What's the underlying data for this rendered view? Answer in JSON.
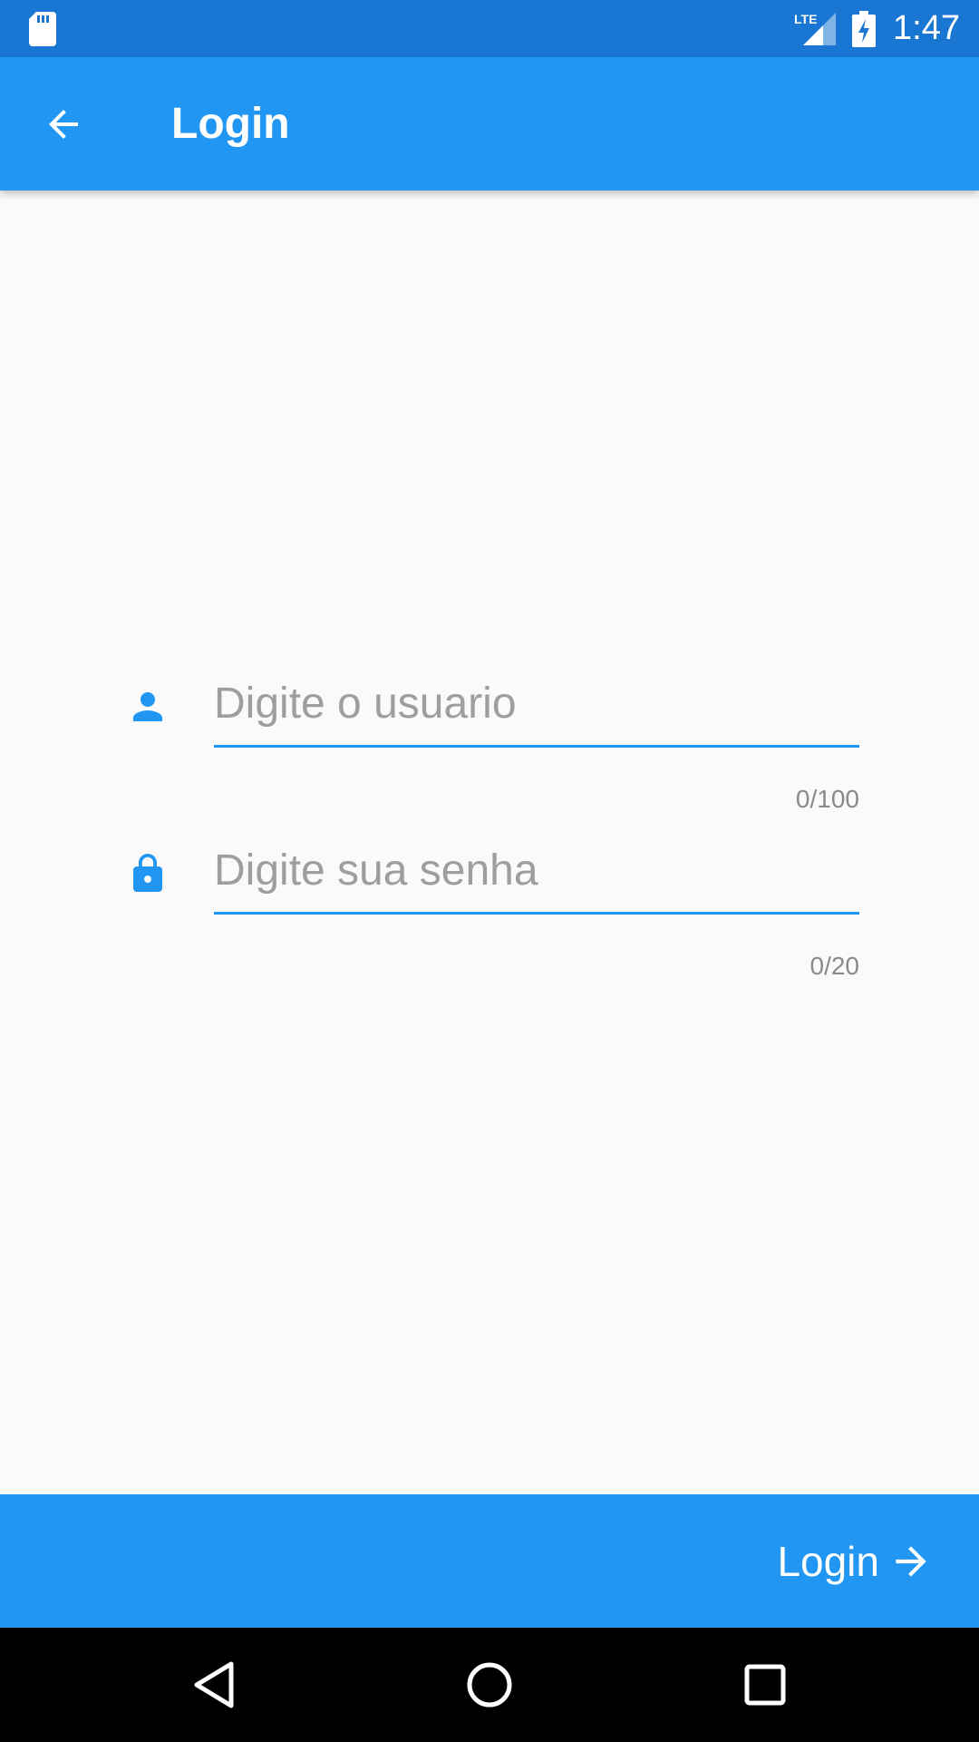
{
  "status_bar": {
    "time": "1:47",
    "network": "LTE",
    "icons": [
      "sd-card-icon",
      "signal-icon",
      "battery-charging-icon"
    ]
  },
  "app_bar": {
    "title": "Login",
    "back_icon": "arrow-back-icon"
  },
  "form": {
    "username": {
      "placeholder": "Digite o usuario",
      "value": "",
      "counter": "0/100",
      "icon": "person-icon"
    },
    "password": {
      "placeholder": "Digite sua senha",
      "value": "",
      "counter": "0/20",
      "icon": "lock-icon"
    }
  },
  "bottom_bar": {
    "login_label": "Login",
    "login_icon": "arrow-forward-icon"
  },
  "nav_bar": {
    "icons": [
      "back-triangle-icon",
      "home-circle-icon",
      "recents-square-icon"
    ]
  },
  "colors": {
    "status_bar": "#1976d2",
    "primary": "#2196f3",
    "background": "#fafafa",
    "placeholder": "#9e9e9e",
    "counter": "#8a8a8a",
    "nav_bar": "#000000"
  }
}
